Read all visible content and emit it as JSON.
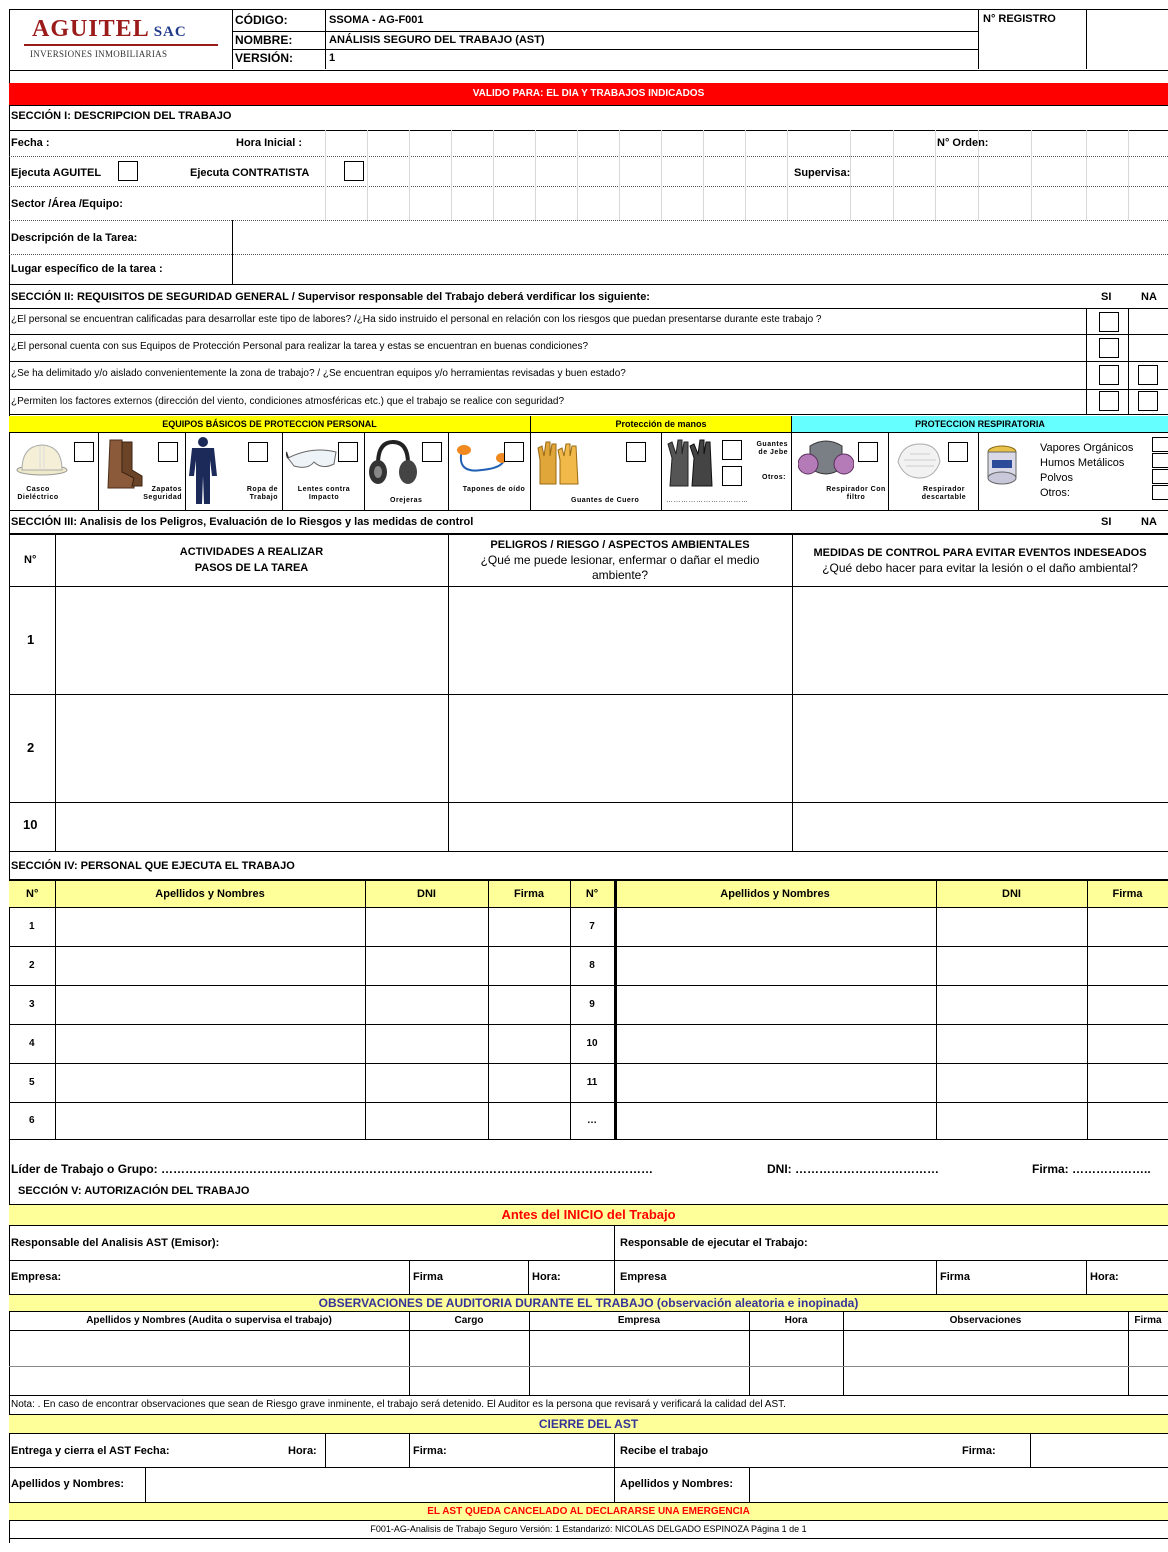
{
  "header": {
    "logo_text": "AGUITEL",
    "logo_sac": "SAC",
    "logo_sub": "INVERSIONES INMOBILIARIAS",
    "codigo_label": "CÓDIGO:",
    "codigo_value": "SSOMA - AG-F001",
    "nombre_label": "NOMBRE:",
    "nombre_value": "ANÁLISIS SEGURO DEL TRABAJO (AST)",
    "version_label": "VERSIÓN:",
    "version_value": "1",
    "registro_label": "N° REGISTRO"
  },
  "valid_banner": "VALIDO PARA:  EL DIA  Y TRABAJOS INDICADOS",
  "section1": {
    "title": "SECCIÓN I: DESCRIPCION DEL TRABAJO",
    "fecha": "Fecha :",
    "hora_inicial": "Hora Inicial :",
    "orden": "N° Orden:",
    "ejecuta_aguitel": "Ejecuta AGUITEL",
    "ejecuta_contratista": "Ejecuta CONTRATISTA",
    "supervisa": "Supervisa:",
    "sector": "Sector /Área /Equipo:",
    "descripcion": "Descripción de la Tarea:",
    "lugar": "Lugar específico de la tarea :"
  },
  "section2": {
    "title": "SECCIÓN II: REQUISITOS DE SEGURIDAD GENERAL  / Supervisor responsable del Trabajo deberá verdificar los siguiente:",
    "si": "SI",
    "na": "NA",
    "questions": [
      "¿El personal se encuentran calificadas para desarrollar este tipo de labores? /¿Ha sido instruido el personal en relación con los riesgos que puedan presentarse durante este trabajo ?",
      "¿El personal cuenta con sus Equipos de Protección Personal para realizar la tarea y estas se encuentran en buenas condiciones?",
      "¿Se ha delimitado y/o aislado convenientemente la zona de trabajo? / ¿Se encuentran equipos y/o herramientas revisadas y buen estado?",
      "¿Permiten los factores externos (dirección del viento, condiciones atmosféricas etc.) que el trabajo se realice con seguridad?"
    ],
    "ppe_header": "EQUIPOS BÁSICOS DE PROTECCION PERSONAL",
    "hands_header": "Protección de manos",
    "resp_header": "PROTECCION RESPIRATORIA",
    "ppe": {
      "casco": "Casco Dieléctrico",
      "zapatos": "Zapatos Seguridad",
      "ropa": "Ropa de Trabajo",
      "lentes": "Lentes contra Impacto",
      "orejeras": "Orejeras",
      "tapones": "Tapones de oído",
      "cuero": "Guantes de Cuero",
      "jebe": "Guantes de Jebe",
      "otros_manos": "Otros:",
      "dots": "……………………………",
      "resp_filtro": "Respirador Con filtro",
      "resp_desc": "Respirador descartable",
      "vapores": "Vapores Orgánicos",
      "humos": "Humos Metálicos",
      "polvos": "Polvos",
      "otros_resp": "Otros:"
    }
  },
  "section3": {
    "title": "SECCIÓN III: Analisis de los Peligros, Evaluación de lo Riesgos y las medidas de control",
    "si": "SI",
    "na": "NA",
    "col_n": "N°",
    "col_act_1": "ACTIVIDADES A REALIZAR",
    "col_act_2": "PASOS DE LA TAREA",
    "col_pel_1": "PELIGROS / RIESGO / ASPECTOS AMBIENTALES",
    "col_pel_2": "¿Qué me puede lesionar, enfermar o dañar el medio ambiente?",
    "col_med_1": "MEDIDAS DE CONTROL PARA EVITAR EVENTOS INDESEADOS",
    "col_med_2": "¿Qué debo hacer para evitar la lesión o el daño ambiental?",
    "rows": [
      "1",
      "2",
      "10"
    ]
  },
  "section4": {
    "title": "SECCIÓN IV: PERSONAL QUE EJECUTA EL TRABAJO",
    "col_n": "N°",
    "col_nombres": "Apellidos y Nombres",
    "col_dni": "DNI",
    "col_firma": "Firma",
    "left_nums": [
      "1",
      "2",
      "3",
      "4",
      "5",
      "6"
    ],
    "right_nums": [
      "7",
      "8",
      "9",
      "10",
      "11",
      "…"
    ],
    "lider": "Líder de Trabajo o Grupo: ……………………………………………………………………………………………………………",
    "lider_dni": "DNI: ………………………………",
    "lider_firma": "Firma: ……………….."
  },
  "section5": {
    "title": "SECCIÓN V: AUTORIZACIÓN DEL TRABAJO",
    "antes": "Antes del INICIO del Trabajo",
    "resp_emisor": "Responsable del Analisis AST (Emisor):",
    "resp_ejecutar": "Responsable de ejecutar el Trabajo:",
    "empresa_l": "Empresa:",
    "firma_l": "Firma",
    "hora_l": "Hora:",
    "empresa_r": "Empresa",
    "firma_r": "Firma",
    "hora_r": "Hora:",
    "observaciones_title": "OBSERVACIONES DE AUDITORIA DURANTE EL TRABAJO (observación aleatoria e inopinada)",
    "obs_cols": [
      "Apellidos y Nombres (Audita o supervisa el trabajo)",
      "Cargo",
      "Empresa",
      "Hora",
      "Observaciones",
      "Firma"
    ],
    "nota": "Nota: . En caso de encontrar observaciones que sean de Riesgo grave inminente, el trabajo será detenido. El Auditor es la persona que revisará y verificará la calidad del AST.",
    "cierre": "CIERRE DEL AST",
    "entrega": "Entrega y cierra el AST  Fecha:",
    "hora": "Hora:",
    "firma": "Firma:",
    "recibe": "Recibe el trabajo",
    "firma2": "Firma:",
    "apellidos": "Apellidos y Nombres:",
    "apellidos2": "Apellidos y Nombres:",
    "cancelado": "EL AST QUEDA CANCELADO AL DECLARARSE UNA EMERGENCIA",
    "footer": "F001-AG-Analisis de Trabajo Seguro   Versión: 1   Estandarizó: NICOLAS DELGADO ESPINOZA  Página 1 de 1"
  },
  "colors": {
    "red": "#ff0000",
    "yellow": "#ffff99",
    "bright_yellow": "#ffff00",
    "cyan": "#66ffff",
    "banner_text": "#ffffff",
    "blue_text": "#333399",
    "red_text": "#ff0000"
  }
}
